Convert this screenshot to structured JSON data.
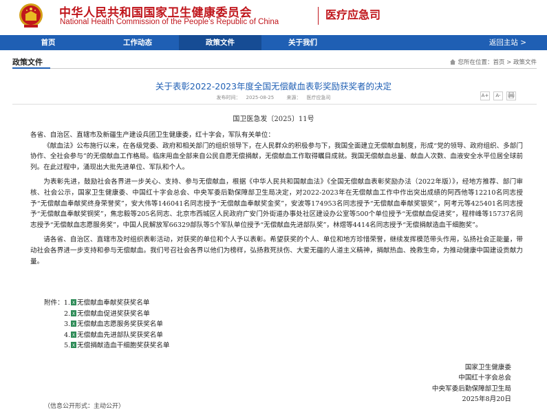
{
  "header": {
    "title_cn": "中华人民共和国国家卫生健康委员会",
    "title_en": "National Health Commission of the People’s Republic of China",
    "department": "医疗应急司",
    "brand_color": "#c0161c"
  },
  "nav": {
    "items": [
      "首页",
      "工作动态",
      "政策文件",
      "关于我们"
    ],
    "active": "政策文件",
    "back": "返回主站 >",
    "color": "#1f5fb4"
  },
  "section": {
    "title": "政策文件",
    "breadcrumb": "您所在位置：首页 > 政策文件"
  },
  "article": {
    "title": "关于表彰2022-2023年度全国无偿献血表彰奖励获奖者的决定",
    "publish_label": "发布时间：",
    "publish_date": "2025-08-25",
    "source_label": "来源：",
    "source": "医疗应急司",
    "font_controls": [
      "A+",
      "A-",
      "print"
    ],
    "doc_number": "国卫医急发〔2025〕11号",
    "paragraphs": [
      "各省、自治区、直辖市及新疆生产建设兵团卫生健康委，红十字会，军队有关单位：",
      "《献血法》公布施行以来，在各级党委、政府和相关部门的组织领导下，在人民群众的积极参与下，我国全面建立无偿献血制度，形成“党的领导、政府组织、多部门协作、全社会参与”的无偿献血工作格局。临床用血全部来自公民自愿无偿捐献，无偿献血工作取得瞩目成就。我国无偿献血总量、献血人次数、血液安全水平位居全球前列。在此过程中，涌现出大批先进单位、军队和个人。",
      "为表彰先进，鼓励社会各界进一步关心、支持、参与无偿献血，根据《中华人民共和国献血法》《全国无偿献血表彰奖励办法（2022年版）》，经地方推荐、部门审核、社会公示，国家卫生健康委、中国红十字会总会、中央军委后勤保障部卫生局决定，对2022-2023年在无偿献血工作中作出突出成绩的阿西他等12210名同志授予“无偿献血奉献奖终身荣誉奖”，安大伟等146041名同志授予“无偿献血奉献奖金奖”，安波等174953名同志授予“无偿献血奉献奖银奖”，阿考元等425401名同志授予“无偿献血奉献奖铜奖”，焦忠毅等205名同志、北京市西城区人民政府广安门外街道办事处社区建设办公室等500个单位授予“无偿献血促进奖”，程梓峰等15737名同志授予“无偿献血志愿服务奖”，中国人民解放军66329部队等5个军队单位授予“无偿献血先进部队奖”，林煜等4414名同志授予“无偿捐献造血干细胞奖”。",
      "请各省、自治区、直辖市及时组织表彰活动，对获奖的单位和个人予以表彰。希望获奖的个人、单位和地方珍惜荣誉，继续发挥模范带头作用，弘扬社会正能量，带动社会各界进一步支持和参与无偿献血。我们号召社会各界以他们为榜样，弘扬救死扶伤、大爱无疆的人道主义精神，捐献热血、挽救生命，为推动健康中国建设贡献力量。"
    ],
    "attachments_label": "附件：",
    "attachments": [
      {
        "no": "1.",
        "name": "无偿献血奉献奖获奖名单"
      },
      {
        "no": "2.",
        "name": "无偿献血促进奖获奖名单"
      },
      {
        "no": "3.",
        "name": "无偿献血志愿服务奖获奖名单"
      },
      {
        "no": "4.",
        "name": "无偿献血先进部队奖获奖名单"
      },
      {
        "no": "5.",
        "name": "无偿捐献造血干细胞奖获奖名单"
      }
    ],
    "signatories": [
      "国家卫生健康委",
      "中国红十字会总会",
      "中央军委后勤保障部卫生局",
      "2025年8月20日"
    ],
    "disclosure": "（信息公开形式：主动公开）"
  }
}
